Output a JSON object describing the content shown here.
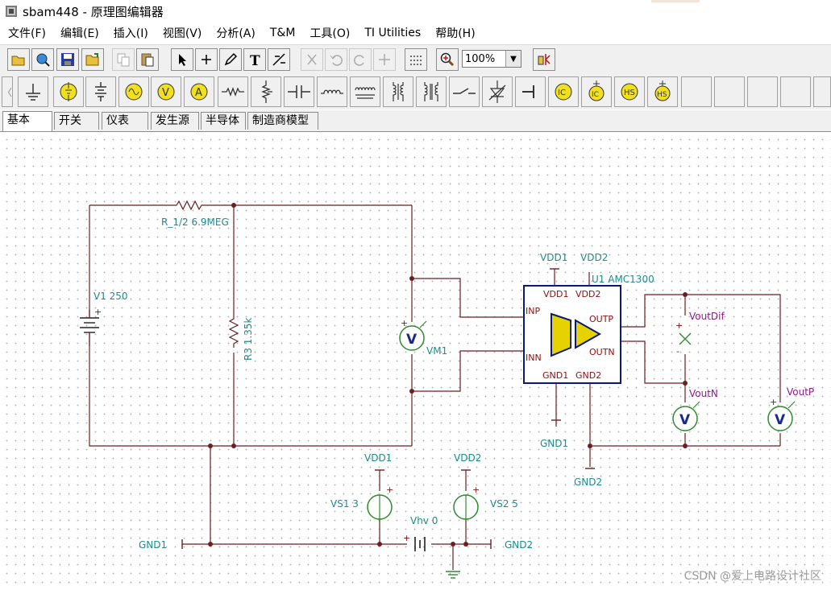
{
  "window": {
    "title": "sbam448 - 原理图编辑器"
  },
  "menu": [
    "文件(F)",
    "编辑(E)",
    "插入(I)",
    "视图(V)",
    "分析(A)",
    "T&M",
    "工具(O)",
    "TI Utilities",
    "帮助(H)"
  ],
  "toolbar": {
    "zoom_value": "100%",
    "buttons": [
      "open-folder-icon",
      "globe-search-icon",
      "save-icon",
      "open-icon",
      "copy-icon",
      "paste-icon",
      "pointer-icon",
      "wire-tool-icon",
      "pencil-icon",
      "text-tool-icon",
      "probe-tool-icon",
      "cut-icon",
      "undo-icon",
      "redo-icon",
      "move-icon",
      "grid-icon",
      "zoom-icon",
      "component-tool-icon"
    ]
  },
  "component_bar": {
    "items": [
      "ground-icon",
      "battery-source-icon",
      "multi-cell-battery-icon",
      "ac-source-icon",
      "voltmeter-icon",
      "ammeter-icon",
      "resistor-icon",
      "potentiometer-icon",
      "capacitor-icon",
      "inductor-icon",
      "transformer-icon",
      "coupled-inductor-icon",
      "transformer-core-icon",
      "switch-icon",
      "diode-variable-icon",
      "terminal-icon",
      "current-controlled-source-ic-icon",
      "voltage-controlled-source-ic-icon",
      "controlled-source-hs-icon",
      "controlled-source-hs2-icon"
    ]
  },
  "tabs": [
    "基本",
    "开关",
    "仪表",
    "发生源",
    "半导体",
    "制造商模型"
  ],
  "schematic": {
    "labels": {
      "r12": "R_1/2 6.9MEG",
      "v1": "V1 250",
      "r3": "R3 1.35k",
      "vm1": "VM1",
      "u1": "U1 AMC1300",
      "vdd1_top": "VDD1",
      "vdd2_top": "VDD2",
      "pin_vdd1": "VDD1",
      "pin_vdd2": "VDD2",
      "pin_inp": "INP",
      "pin_inn": "INN",
      "pin_outp": "OUTP",
      "pin_outn": "OUTN",
      "pin_gnd1": "GND1",
      "pin_gnd2": "GND2",
      "gnd1_u": "GND1",
      "gnd2_u": "GND2",
      "voutdif": "VoutDif",
      "voutn": "VoutN",
      "voutp": "VoutP",
      "vdd1_src": "VDD1",
      "vdd2_src": "VDD2",
      "vs1": "VS1 3",
      "vs2": "VS2 5",
      "vhv": "Vhv 0",
      "gnd1_left": "GND1",
      "gnd2_right": "GND2",
      "meter_v": "V",
      "plus": "+",
      "minus": "-"
    }
  },
  "watermark": "CSDN @爱上电路设计社区",
  "colors": {
    "wire": "#6b1f1f",
    "label": "#1d8c8c",
    "meter": "#2e8b2e",
    "chip_fill": "#e6d200",
    "chip_outline": "#0a1a7a"
  }
}
